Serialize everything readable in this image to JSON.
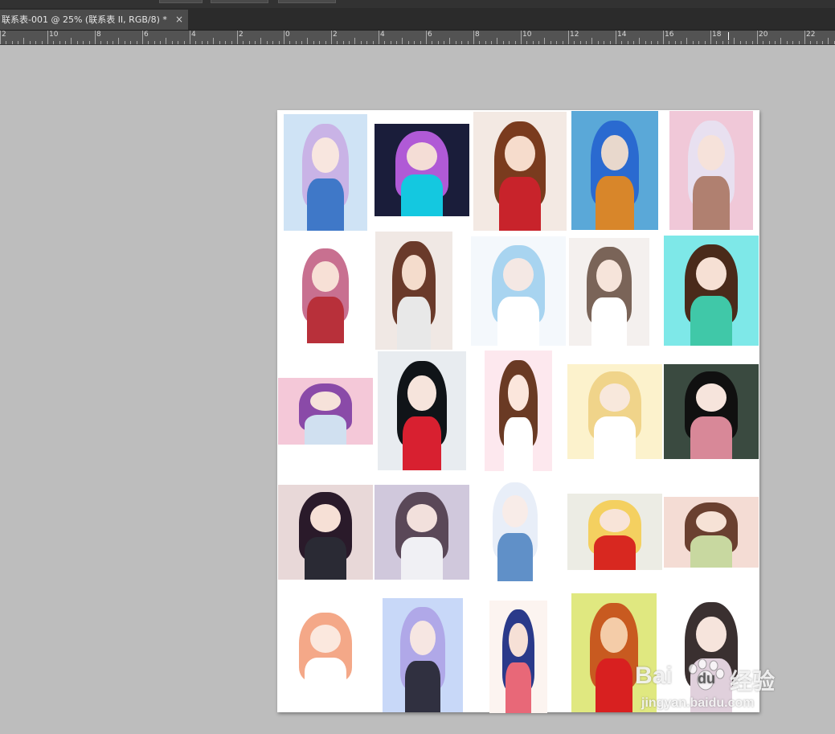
{
  "document_tab": {
    "title": "联系表-001 @ 25% (联系表 II, RGB/8) *",
    "close_glyph": "×"
  },
  "ruler": {
    "labels": [
      "2",
      "10",
      "8",
      "6",
      "4",
      "2",
      "0",
      "2",
      "4",
      "6",
      "8",
      "10",
      "12",
      "14",
      "16",
      "18",
      "20",
      "22"
    ]
  },
  "watermark": {
    "brand": "Bai",
    "brand_suffix": "du",
    "product": "经验",
    "url": "jingyan.baidu.com"
  },
  "thumbnails": [
    {
      "name": "thumb-r1c1",
      "bg": "#cfe3f5",
      "hair": "#c9b3e6",
      "skin": "#f8e6df",
      "cloth": "#3f78c8"
    },
    {
      "name": "thumb-r1c2",
      "bg": "#1a1d3a",
      "hair": "#b05ad6",
      "skin": "#f4ddd6",
      "cloth": "#14c8e0"
    },
    {
      "name": "thumb-r1c3",
      "bg": "#f3e9e3",
      "hair": "#7a3b1e",
      "skin": "#f6dccc",
      "cloth": "#c8232b"
    },
    {
      "name": "thumb-r1c4",
      "bg": "#5aa8d8",
      "hair": "#2a6ad0",
      "skin": "#e8d8cc",
      "cloth": "#d8862a"
    },
    {
      "name": "thumb-r1c5",
      "bg": "#f0c8d8",
      "hair": "#e8e0f0",
      "skin": "#f6e2da",
      "cloth": "#b08070"
    },
    {
      "name": "thumb-r2c1",
      "bg": "#ffffff",
      "hair": "#c87090",
      "skin": "#f7e0d6",
      "cloth": "#b8303a"
    },
    {
      "name": "thumb-r2c2",
      "bg": "#f0e8e4",
      "hair": "#6a3a2a",
      "skin": "#f4dccc",
      "cloth": "#e8e8e8"
    },
    {
      "name": "thumb-r2c3",
      "bg": "#f4f8fc",
      "hair": "#a8d4f0",
      "skin": "#f4e8e4",
      "cloth": "#ffffff"
    },
    {
      "name": "thumb-r2c4",
      "bg": "#f4f0ee",
      "hair": "#7a6458",
      "skin": "#f6e4da",
      "cloth": "#ffffff"
    },
    {
      "name": "thumb-r2c5",
      "bg": "#7ee8e8",
      "hair": "#4a2a1a",
      "skin": "#f6e0d4",
      "cloth": "#40c8a8"
    },
    {
      "name": "thumb-r3c1",
      "bg": "#f4c8d8",
      "hair": "#8a4aa8",
      "skin": "#f6e2da",
      "cloth": "#d0e0f0"
    },
    {
      "name": "thumb-r3c2",
      "bg": "#e8ecf0",
      "hair": "#101418",
      "skin": "#f6e4dc",
      "cloth": "#d82030"
    },
    {
      "name": "thumb-r3c3",
      "bg": "#fde8ee",
      "hair": "#6a3a24",
      "skin": "#fbe6dc",
      "cloth": "#ffffff"
    },
    {
      "name": "thumb-r3c4",
      "bg": "#fcf2cc",
      "hair": "#f0d48a",
      "skin": "#f8e8dc",
      "cloth": "#ffffff"
    },
    {
      "name": "thumb-r3c5",
      "bg": "#3a4a40",
      "hair": "#101010",
      "skin": "#f6e4dc",
      "cloth": "#d88898"
    },
    {
      "name": "thumb-r4c1",
      "bg": "#e8d8d8",
      "hair": "#2a1a2a",
      "skin": "#f6e0d6",
      "cloth": "#2a2a34"
    },
    {
      "name": "thumb-r4c2",
      "bg": "#d0c8dc",
      "hair": "#5a4858",
      "skin": "#f2e0dc",
      "cloth": "#f0f0f4"
    },
    {
      "name": "thumb-r4c3",
      "bg": "#ffffff",
      "hair": "#e8eef8",
      "skin": "#f8ece8",
      "cloth": "#6090c8"
    },
    {
      "name": "thumb-r4c4",
      "bg": "#ecece4",
      "hair": "#f4d060",
      "skin": "#f8e4d8",
      "cloth": "#d82820"
    },
    {
      "name": "thumb-r4c5",
      "bg": "#f4dcd4",
      "hair": "#6a4030",
      "skin": "#f6e2d6",
      "cloth": "#c8d8a0"
    },
    {
      "name": "thumb-r5c1",
      "bg": "#ffffff",
      "hair": "#f4a888",
      "skin": "#fbe8de",
      "cloth": "#ffffff"
    },
    {
      "name": "thumb-r5c2",
      "bg": "#c8d8f8",
      "hair": "#b0a8e8",
      "skin": "#f6e6e2",
      "cloth": "#303040"
    },
    {
      "name": "thumb-r5c3",
      "bg": "#fcf4f0",
      "hair": "#2a3a8a",
      "skin": "#f6e0d6",
      "cloth": "#e86878"
    },
    {
      "name": "thumb-r5c4",
      "bg": "#e0e880",
      "hair": "#c85a20",
      "skin": "#f4cca8",
      "cloth": "#d82020"
    },
    {
      "name": "thumb-r5c5",
      "bg": "#ffffff",
      "hair": "#3a3030",
      "skin": "#f6e4dc",
      "cloth": "#e0d0dc"
    }
  ]
}
